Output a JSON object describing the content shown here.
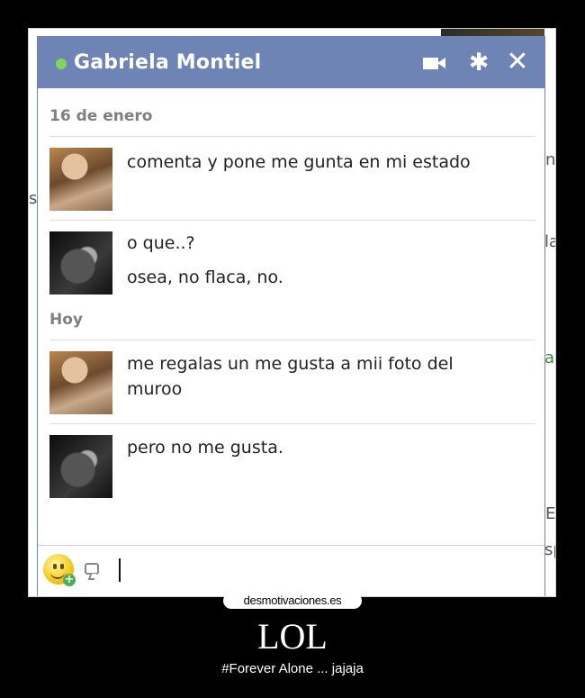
{
  "chat": {
    "contact_name": "Gabriela Montiel",
    "status": "online",
    "icons": [
      "video-call-icon",
      "gear-icon",
      "close-icon"
    ],
    "close_glyph": "✕",
    "gear_glyph": "✱"
  },
  "conversation": [
    {
      "date_label": "16 de enero",
      "messages": [
        {
          "sender": "girl",
          "lines": [
            "comenta y pone me gunta en mi estado"
          ]
        },
        {
          "sender": "boy",
          "lines": [
            "o que..?",
            "osea, no flaca, no."
          ]
        }
      ]
    },
    {
      "date_label": "Hoy",
      "messages": [
        {
          "sender": "girl",
          "lines": [
            "me regalas un me gusta a mii foto del",
            "muroo"
          ]
        },
        {
          "sender": "boy",
          "lines": [
            "pero no me gusta."
          ]
        }
      ]
    }
  ],
  "composer": {
    "value": "",
    "icons": [
      "emoji-icon",
      "sticker-icon"
    ]
  },
  "background_fragments": [
    "s",
    "n",
    "la",
    "a",
    "E",
    "sp"
  ],
  "poster": {
    "site": "desmotivaciones.es",
    "title": "LOL",
    "caption": "#Forever Alone ... jajaja"
  },
  "colors": {
    "titlebar": "#6d84b4",
    "online": "#7fd65a",
    "background": "#000000"
  }
}
